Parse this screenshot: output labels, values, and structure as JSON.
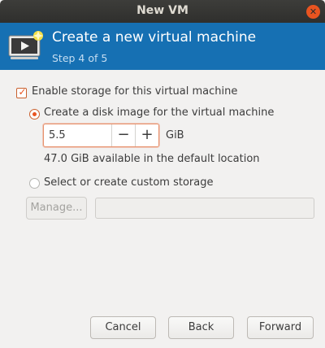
{
  "window": {
    "title": "New VM",
    "close_icon": "close-icon"
  },
  "header": {
    "title": "Create a new virtual machine",
    "step": "Step 4 of 5",
    "icon": "monitor-play-icon",
    "colors": {
      "banner": "#1670b3",
      "accent": "#e95420"
    }
  },
  "storage": {
    "enable_label": "Enable storage for this virtual machine",
    "enable_checked": true,
    "disk_image_label": "Create a disk image for the virtual machine",
    "disk_image_selected": true,
    "size_value": "5.5",
    "minus_label": "−",
    "plus_label": "+",
    "unit": "GiB",
    "available_text": "47.0 GiB available in the default location",
    "custom_label": "Select or create custom storage",
    "custom_selected": false,
    "manage_label": "Manage...",
    "custom_path_value": ""
  },
  "footer": {
    "cancel_label": "Cancel",
    "back_label": "Back",
    "forward_label": "Forward"
  }
}
